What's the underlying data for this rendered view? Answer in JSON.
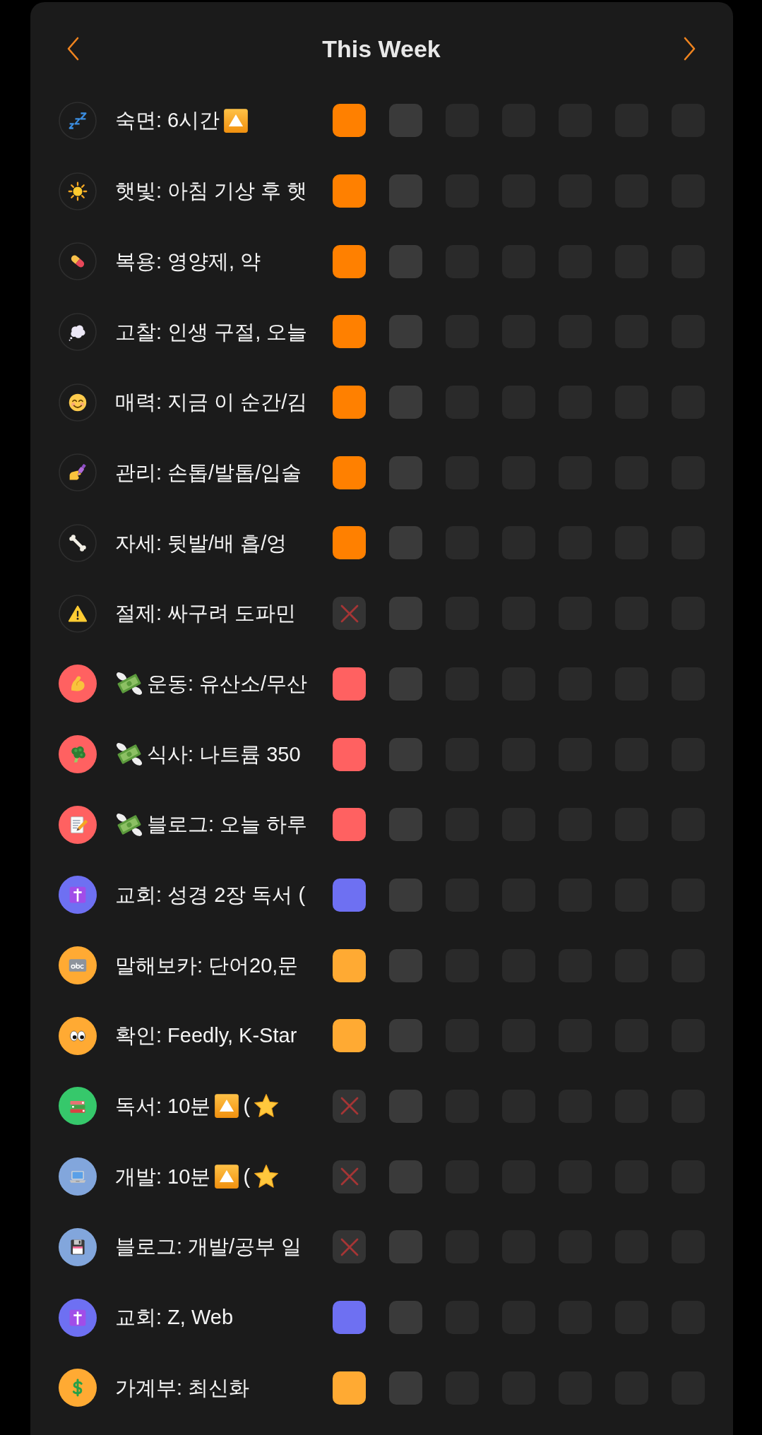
{
  "header": {
    "title": "This Week"
  },
  "rows": [
    {
      "icon_filled": false,
      "color": "#ff8000",
      "label": [
        {
          "kind": "text",
          "text": "숙면: 6시간"
        },
        {
          "kind": "up_box"
        }
      ],
      "days": [
        {
          "kind": "done"
        },
        {
          "kind": "pending"
        },
        {
          "kind": "upcoming"
        },
        {
          "kind": "upcoming"
        },
        {
          "kind": "upcoming"
        },
        {
          "kind": "upcoming"
        },
        {
          "kind": "upcoming"
        }
      ]
    },
    {
      "icon_filled": false,
      "color": "#ff8000",
      "label": [
        {
          "kind": "text",
          "text": "햇빛: 아침 기상 후 햇"
        }
      ],
      "days": [
        {
          "kind": "done"
        },
        {
          "kind": "pending"
        },
        {
          "kind": "upcoming"
        },
        {
          "kind": "upcoming"
        },
        {
          "kind": "upcoming"
        },
        {
          "kind": "upcoming"
        },
        {
          "kind": "upcoming"
        }
      ]
    },
    {
      "icon_filled": false,
      "color": "#ff8000",
      "label": [
        {
          "kind": "text",
          "text": "복용: 영양제, 약"
        }
      ],
      "days": [
        {
          "kind": "done"
        },
        {
          "kind": "pending"
        },
        {
          "kind": "upcoming"
        },
        {
          "kind": "upcoming"
        },
        {
          "kind": "upcoming"
        },
        {
          "kind": "upcoming"
        },
        {
          "kind": "upcoming"
        }
      ]
    },
    {
      "icon_filled": false,
      "color": "#ff8000",
      "label": [
        {
          "kind": "text",
          "text": "고찰: 인생 구절, 오늘"
        }
      ],
      "days": [
        {
          "kind": "done"
        },
        {
          "kind": "pending"
        },
        {
          "kind": "upcoming"
        },
        {
          "kind": "upcoming"
        },
        {
          "kind": "upcoming"
        },
        {
          "kind": "upcoming"
        },
        {
          "kind": "upcoming"
        }
      ]
    },
    {
      "icon_filled": false,
      "color": "#ff8000",
      "label": [
        {
          "kind": "text",
          "text": "매력: 지금 이 순간/김"
        }
      ],
      "days": [
        {
          "kind": "done"
        },
        {
          "kind": "pending"
        },
        {
          "kind": "upcoming"
        },
        {
          "kind": "upcoming"
        },
        {
          "kind": "upcoming"
        },
        {
          "kind": "upcoming"
        },
        {
          "kind": "upcoming"
        }
      ]
    },
    {
      "icon_filled": false,
      "color": "#ff8000",
      "label": [
        {
          "kind": "text",
          "text": "관리: 손톱/발톱/입술"
        }
      ],
      "days": [
        {
          "kind": "done"
        },
        {
          "kind": "pending"
        },
        {
          "kind": "upcoming"
        },
        {
          "kind": "upcoming"
        },
        {
          "kind": "upcoming"
        },
        {
          "kind": "upcoming"
        },
        {
          "kind": "upcoming"
        }
      ]
    },
    {
      "icon_filled": false,
      "color": "#ff8000",
      "label": [
        {
          "kind": "text",
          "text": "자세: 뒷발/배 흡/엉"
        }
      ],
      "days": [
        {
          "kind": "done"
        },
        {
          "kind": "pending"
        },
        {
          "kind": "upcoming"
        },
        {
          "kind": "upcoming"
        },
        {
          "kind": "upcoming"
        },
        {
          "kind": "upcoming"
        },
        {
          "kind": "upcoming"
        }
      ]
    },
    {
      "icon_filled": false,
      "label": [
        {
          "kind": "text",
          "text": "절제: 싸구려 도파민"
        }
      ],
      "days": [
        {
          "kind": "missed"
        },
        {
          "kind": "pending"
        },
        {
          "kind": "upcoming"
        },
        {
          "kind": "upcoming"
        },
        {
          "kind": "upcoming"
        },
        {
          "kind": "upcoming"
        },
        {
          "kind": "upcoming"
        }
      ]
    },
    {
      "icon_filled": true,
      "color": "#ff6161",
      "label": [
        {
          "kind": "money"
        },
        {
          "kind": "text",
          "text": "운동: 유산소/무산"
        }
      ],
      "days": [
        {
          "kind": "done"
        },
        {
          "kind": "pending"
        },
        {
          "kind": "upcoming"
        },
        {
          "kind": "upcoming"
        },
        {
          "kind": "upcoming"
        },
        {
          "kind": "upcoming"
        },
        {
          "kind": "upcoming"
        }
      ]
    },
    {
      "icon_filled": true,
      "color": "#ff6161",
      "label": [
        {
          "kind": "money"
        },
        {
          "kind": "text",
          "text": "식사: 나트륨 350"
        }
      ],
      "days": [
        {
          "kind": "done"
        },
        {
          "kind": "pending"
        },
        {
          "kind": "upcoming"
        },
        {
          "kind": "upcoming"
        },
        {
          "kind": "upcoming"
        },
        {
          "kind": "upcoming"
        },
        {
          "kind": "upcoming"
        }
      ]
    },
    {
      "icon_filled": true,
      "color": "#ff6161",
      "label": [
        {
          "kind": "money"
        },
        {
          "kind": "text",
          "text": "블로그: 오늘 하루"
        }
      ],
      "days": [
        {
          "kind": "done"
        },
        {
          "kind": "pending"
        },
        {
          "kind": "upcoming"
        },
        {
          "kind": "upcoming"
        },
        {
          "kind": "upcoming"
        },
        {
          "kind": "upcoming"
        },
        {
          "kind": "upcoming"
        }
      ]
    },
    {
      "icon_filled": true,
      "color": "#6e70f2",
      "label": [
        {
          "kind": "text",
          "text": "교회: 성경 2장 독서 ("
        }
      ],
      "days": [
        {
          "kind": "done"
        },
        {
          "kind": "pending"
        },
        {
          "kind": "upcoming"
        },
        {
          "kind": "upcoming"
        },
        {
          "kind": "upcoming"
        },
        {
          "kind": "upcoming"
        },
        {
          "kind": "upcoming"
        }
      ]
    },
    {
      "icon_filled": true,
      "color": "#ffaa33",
      "label": [
        {
          "kind": "text",
          "text": "말해보카: 단어20,문"
        }
      ],
      "days": [
        {
          "kind": "done"
        },
        {
          "kind": "pending"
        },
        {
          "kind": "upcoming"
        },
        {
          "kind": "upcoming"
        },
        {
          "kind": "upcoming"
        },
        {
          "kind": "upcoming"
        },
        {
          "kind": "upcoming"
        }
      ]
    },
    {
      "icon_filled": true,
      "color": "#ffaa33",
      "label": [
        {
          "kind": "text",
          "text": "확인: Feedly, K-Star"
        }
      ],
      "days": [
        {
          "kind": "done"
        },
        {
          "kind": "pending"
        },
        {
          "kind": "upcoming"
        },
        {
          "kind": "upcoming"
        },
        {
          "kind": "upcoming"
        },
        {
          "kind": "upcoming"
        },
        {
          "kind": "upcoming"
        }
      ]
    },
    {
      "icon_filled": true,
      "color": "#36c86b",
      "label": [
        {
          "kind": "text",
          "text": "독서: 10분"
        },
        {
          "kind": "up_box"
        },
        {
          "kind": "text",
          "text": "("
        },
        {
          "kind": "star"
        }
      ],
      "days": [
        {
          "kind": "missed"
        },
        {
          "kind": "pending"
        },
        {
          "kind": "upcoming"
        },
        {
          "kind": "upcoming"
        },
        {
          "kind": "upcoming"
        },
        {
          "kind": "upcoming"
        },
        {
          "kind": "upcoming"
        }
      ]
    },
    {
      "icon_filled": true,
      "color": "#82a6dc",
      "label": [
        {
          "kind": "text",
          "text": "개발: 10분"
        },
        {
          "kind": "up_box"
        },
        {
          "kind": "text",
          "text": "("
        },
        {
          "kind": "star"
        }
      ],
      "days": [
        {
          "kind": "missed"
        },
        {
          "kind": "pending"
        },
        {
          "kind": "upcoming"
        },
        {
          "kind": "upcoming"
        },
        {
          "kind": "upcoming"
        },
        {
          "kind": "upcoming"
        },
        {
          "kind": "upcoming"
        }
      ]
    },
    {
      "icon_filled": true,
      "color": "#82a6dc",
      "label": [
        {
          "kind": "text",
          "text": "블로그: 개발/공부 일"
        }
      ],
      "days": [
        {
          "kind": "missed"
        },
        {
          "kind": "pending"
        },
        {
          "kind": "upcoming"
        },
        {
          "kind": "upcoming"
        },
        {
          "kind": "upcoming"
        },
        {
          "kind": "upcoming"
        },
        {
          "kind": "upcoming"
        }
      ]
    },
    {
      "icon_filled": true,
      "color": "#6e70f2",
      "label": [
        {
          "kind": "text",
          "text": "교회: Z, Web"
        }
      ],
      "days": [
        {
          "kind": "done"
        },
        {
          "kind": "pending"
        },
        {
          "kind": "upcoming"
        },
        {
          "kind": "upcoming"
        },
        {
          "kind": "upcoming"
        },
        {
          "kind": "upcoming"
        },
        {
          "kind": "upcoming"
        }
      ]
    },
    {
      "icon_filled": true,
      "color": "#ffaa33",
      "label": [
        {
          "kind": "text",
          "text": "가계부: 최신화"
        }
      ],
      "days": [
        {
          "kind": "done"
        },
        {
          "kind": "pending"
        },
        {
          "kind": "upcoming"
        },
        {
          "kind": "upcoming"
        },
        {
          "kind": "upcoming"
        },
        {
          "kind": "upcoming"
        },
        {
          "kind": "upcoming"
        }
      ]
    }
  ]
}
